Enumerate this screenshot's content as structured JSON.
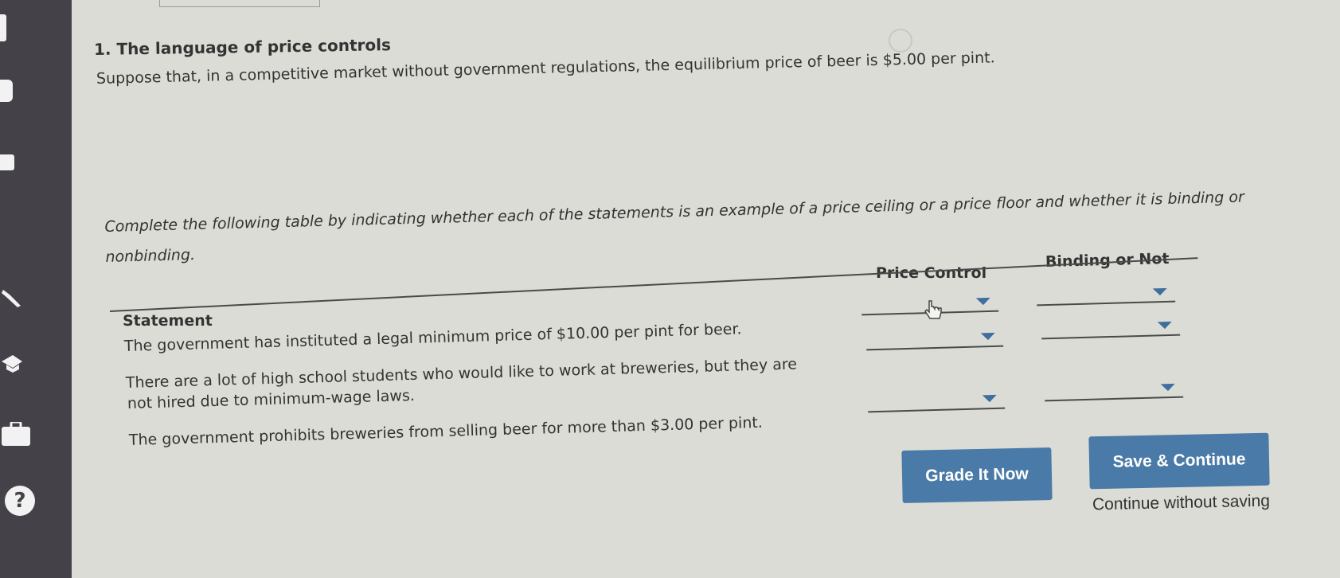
{
  "sidebar": {
    "icons": [
      "bar-icon",
      "tab-icon",
      "grid-icon",
      "wrench-icon",
      "graduation-cap-icon",
      "briefcase-icon",
      "help-icon"
    ],
    "help_label": "?"
  },
  "question": {
    "title": "1. The language of price controls",
    "intro": "Suppose that, in a competitive market without government regulations, the equilibrium price of beer is $5.00 per pint.",
    "instruction": "Complete the following table by indicating whether each of the statements is an example of a price ceiling or a price floor and whether it is binding or nonbinding."
  },
  "table": {
    "headers": {
      "statement": "Statement",
      "price_control": "Price Control",
      "binding": "Binding or Not"
    },
    "rows": [
      {
        "statement": "The government has instituted a legal minimum price of $10.00 per pint for beer.",
        "price_control": "",
        "binding": ""
      },
      {
        "statement_line1": "There are a lot of high school students who would like to work at breweries, but they are",
        "statement_line2": "not hired due to minimum-wage laws.",
        "price_control": "",
        "binding": ""
      },
      {
        "statement": "The government prohibits breweries from selling beer for more than $3.00 per pint.",
        "price_control": "",
        "binding": ""
      }
    ]
  },
  "actions": {
    "grade": "Grade It Now",
    "save": "Save & Continue",
    "continue_without_saving": "Continue without saving"
  },
  "colors": {
    "accent": "#4a7aa7",
    "sidebar": "#454149",
    "background": "#dcdcd6"
  }
}
